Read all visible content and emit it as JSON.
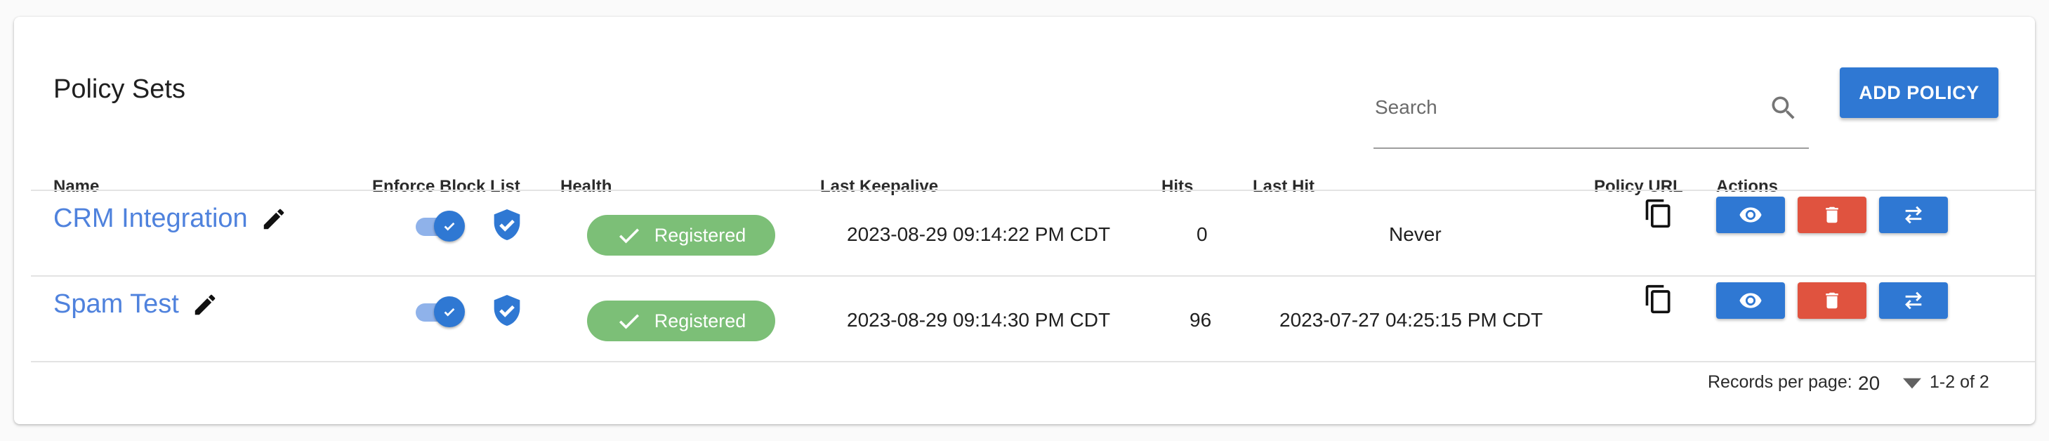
{
  "page": {
    "title": "Policy Sets"
  },
  "search": {
    "placeholder": "Search",
    "value": ""
  },
  "toolbar": {
    "add_label": "ADD POLICY"
  },
  "columns": {
    "name": "Name",
    "enforce": "Enforce Block List",
    "health": "Health",
    "last_keepalive": "Last Keepalive",
    "hits": "Hits",
    "last_hit": "Last Hit",
    "policy_url": "Policy URL",
    "actions": "Actions"
  },
  "rows": [
    {
      "name": "CRM Integration",
      "enforce_block_list": true,
      "health": "Registered",
      "last_keepalive": "2023-08-29 09:14:22 PM CDT",
      "hits": "0",
      "last_hit": "Never"
    },
    {
      "name": "Spam Test",
      "enforce_block_list": true,
      "health": "Registered",
      "last_keepalive": "2023-08-29 09:14:30 PM CDT",
      "hits": "96",
      "last_hit": "2023-07-27 04:25:15 PM CDT"
    }
  ],
  "pagination": {
    "records_per_page_label": "Records per page:",
    "records_per_page": "20",
    "range": "1-2 of 2"
  },
  "icons": {
    "search": "search-icon",
    "edit": "pencil-icon",
    "shield": "shield-check-icon",
    "health": "check-icon",
    "copy": "copy-icon",
    "view": "eye-icon",
    "delete": "trash-icon",
    "move": "swap-arrows-icon",
    "dropdown": "caret-down-icon"
  },
  "colors": {
    "primary": "#2f78d3",
    "danger": "#e0533f",
    "success": "#7cbf77",
    "link": "#4f82dd"
  }
}
